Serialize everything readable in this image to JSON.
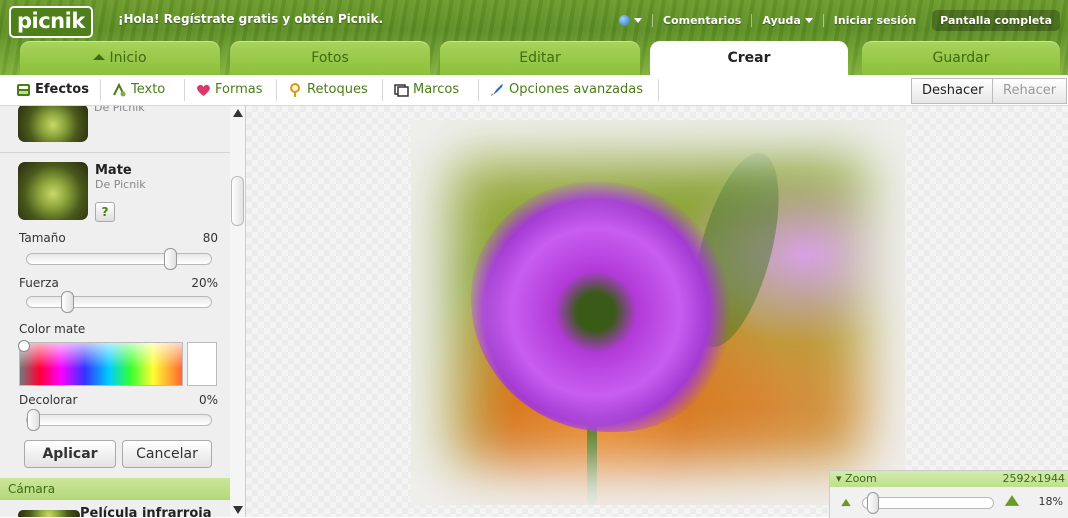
{
  "topbar": {
    "logo": "picnik",
    "promo": "¡Hola! Regístrate gratis y obtén Picnik.",
    "links": {
      "comments": "Comentarios",
      "help": "Ayuda",
      "signin": "Iniciar sesión",
      "fullscreen": "Pantalla completa"
    }
  },
  "tabs": {
    "home": "Inicio",
    "photos": "Fotos",
    "edit": "Editar",
    "create": "Crear",
    "save": "Guardar"
  },
  "subbar": {
    "effects": "Efectos",
    "text": "Texto",
    "shapes": "Formas",
    "touchup": "Retoques",
    "frames": "Marcos",
    "advanced": "Opciones avanzadas",
    "undo": "Deshacer",
    "redo": "Rehacer"
  },
  "panel": {
    "prev_by": "De Picnik",
    "effect": {
      "title": "Mate",
      "by": "De Picnik",
      "help": "?"
    },
    "size": {
      "label": "Tamaño",
      "value": "80",
      "level": 0.8
    },
    "strength": {
      "label": "Fuerza",
      "value": "20%",
      "level": 0.2
    },
    "color_label": "Color mate",
    "fade": {
      "label": "Decolorar",
      "value": "0%",
      "level": 0
    },
    "apply": "Aplicar",
    "cancel": "Cancelar",
    "section": "Cámara",
    "next_effect": "Película infrarroja"
  },
  "zoom": {
    "label": "Zoom",
    "dimensions": "2592x1944",
    "percent": "18%"
  },
  "colors": {
    "accent_green": "#6a9a2a",
    "tab_green": "#8cc03c",
    "link_green": "#4a7d17"
  }
}
